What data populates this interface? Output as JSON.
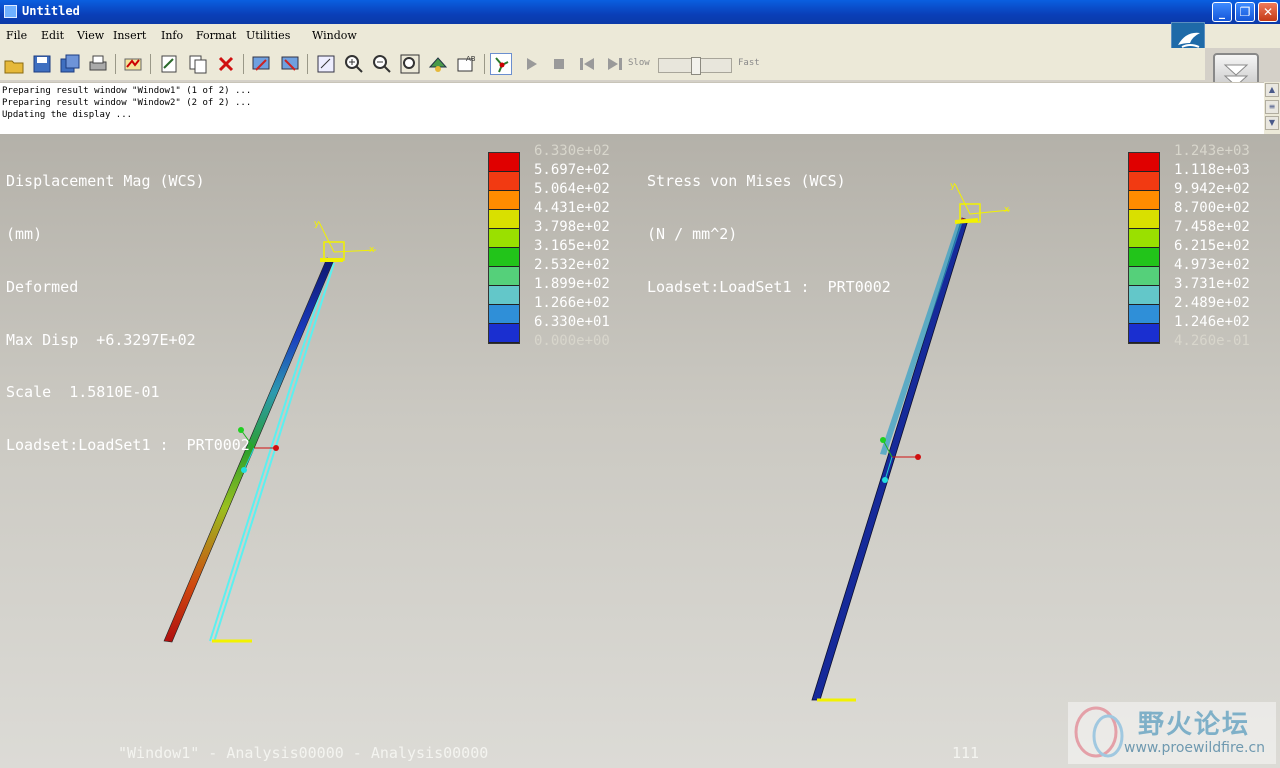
{
  "window": {
    "title": "Untitled"
  },
  "menu": [
    "File",
    "Edit",
    "View",
    "Insert",
    "Info",
    "Format",
    "Utilities",
    "Window"
  ],
  "toolbar": {
    "slow_label": "Slow",
    "fast_label": "Fast",
    "speed_slider_fraction": 0.5
  },
  "messages": [
    "Preparing result window \"Window1\" (1 of 2) ...",
    "Preparing result window \"Window2\" (2 of 2) ...",
    "Updating the display ..."
  ],
  "left_view": {
    "header_lines": [
      "Displacement Mag (WCS)",
      "(mm)",
      "Deformed",
      "Max Disp  +6.3297E+02",
      "Scale  1.5810E-01",
      "Loadset:LoadSet1 :  PRT0002"
    ],
    "legend_values": [
      "6.330e+02",
      "5.697e+02",
      "5.064e+02",
      "4.431e+02",
      "3.798e+02",
      "3.165e+02",
      "2.532e+02",
      "1.899e+02",
      "1.266e+02",
      "6.330e+01",
      "0.000e+00"
    ],
    "footer": "\"Window1\" - Analysis00000 - Analysis00000"
  },
  "right_view": {
    "header_lines": [
      "Stress von Mises (WCS)",
      "(N / mm^2)",
      "Loadset:LoadSet1 :  PRT0002"
    ],
    "legend_values": [
      "1.243e+03",
      "1.118e+03",
      "9.942e+02",
      "8.700e+02",
      "7.458e+02",
      "6.215e+02",
      "4.973e+02",
      "3.731e+02",
      "2.489e+02",
      "1.246e+02",
      "4.260e-01"
    ],
    "footer": "111"
  },
  "legend_colors": [
    "#e00000",
    "#f23a12",
    "#ff8c00",
    "#d9e000",
    "#9ae000",
    "#22c41a",
    "#55d07a",
    "#63c7c9",
    "#2f8fd8",
    "#1a2fd0",
    "#151e7a"
  ],
  "watermark": {
    "cn": "野火论坛",
    "url": "www.proewildfire.cn"
  }
}
